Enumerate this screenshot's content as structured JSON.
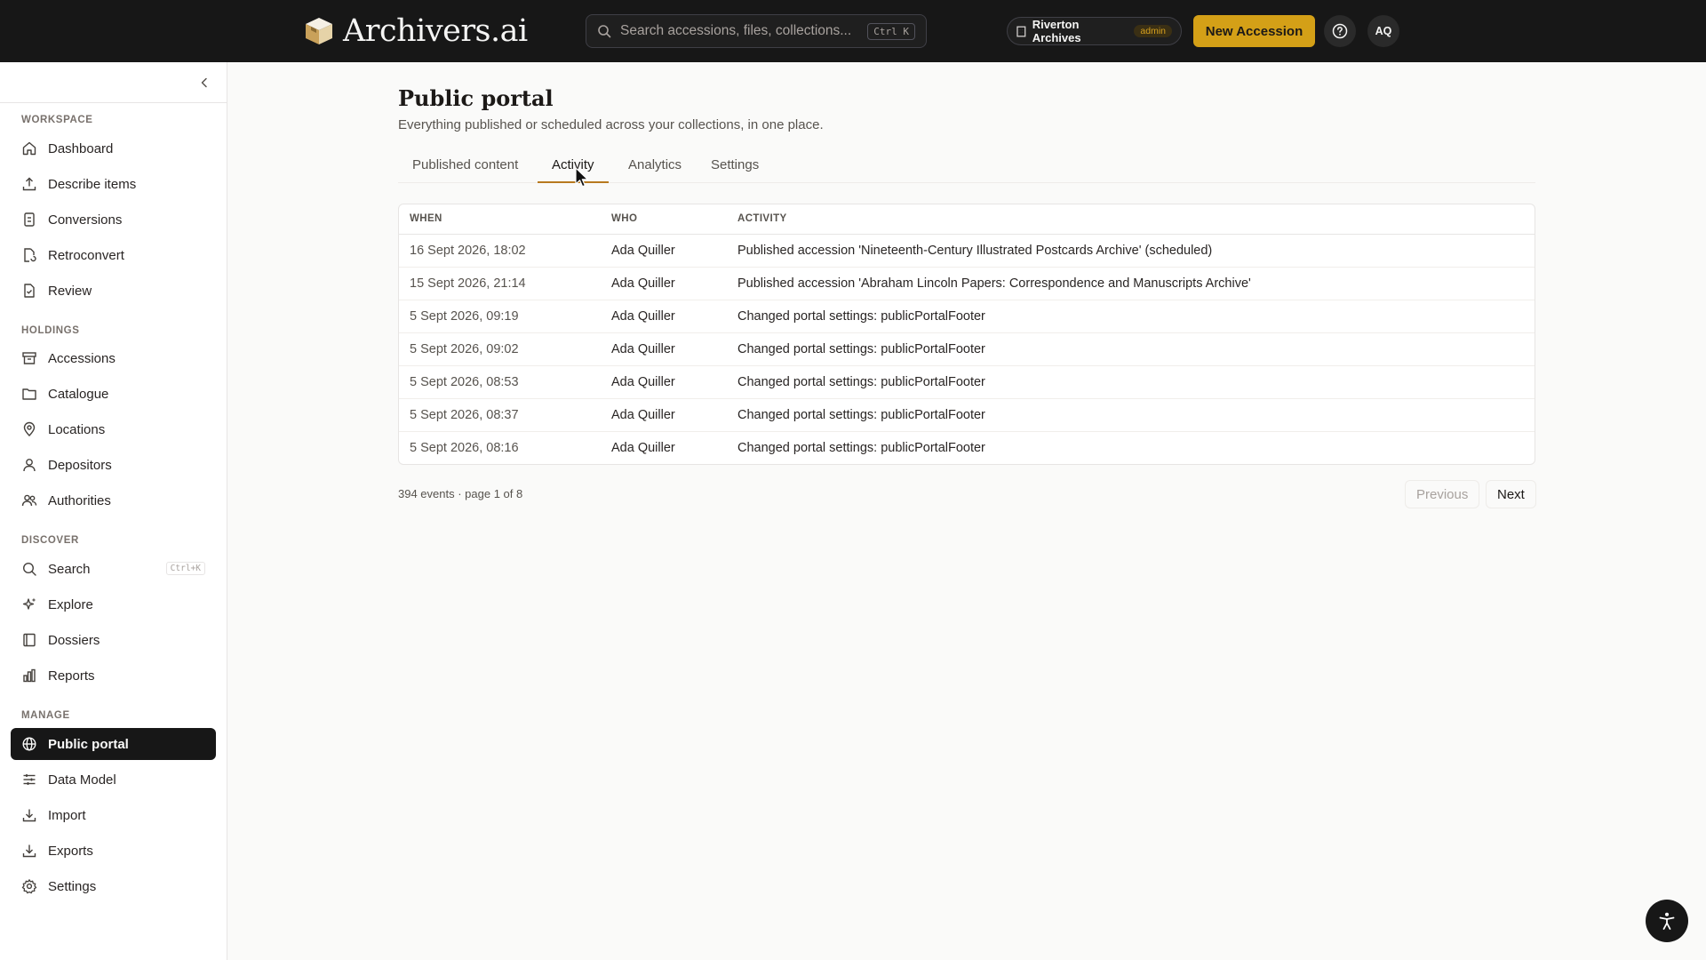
{
  "header": {
    "brand": "Archivers.ai",
    "search_placeholder": "Search accessions, files, collections...",
    "search_shortcut": "Ctrl K",
    "org_name": "Riverton Archives",
    "org_role": "admin",
    "new_accession_label": "New Accession",
    "avatar_initials": "AQ"
  },
  "sidebar": {
    "sections": [
      {
        "label": "WORKSPACE",
        "items": [
          "Dashboard",
          "Describe items",
          "Conversions",
          "Retroconvert",
          "Review"
        ]
      },
      {
        "label": "HOLDINGS",
        "items": [
          "Accessions",
          "Catalogue",
          "Locations",
          "Depositors",
          "Authorities"
        ]
      },
      {
        "label": "DISCOVER",
        "items": [
          "Search",
          "Explore",
          "Dossiers",
          "Reports"
        ]
      },
      {
        "label": "MANAGE",
        "items": [
          "Public portal",
          "Data Model",
          "Import",
          "Exports",
          "Settings"
        ]
      }
    ],
    "search_shortcut": "Ctrl+K",
    "active_item": "Public portal"
  },
  "main": {
    "title": "Public portal",
    "subtitle": "Everything published or scheduled across your collections, in one place.",
    "tabs": [
      "Published content",
      "Activity",
      "Analytics",
      "Settings"
    ],
    "active_tab": "Activity",
    "table": {
      "columns": [
        "WHEN",
        "WHO",
        "ACTIVITY"
      ],
      "rows": [
        [
          "16 Sept 2026, 18:02",
          "Ada Quiller",
          "Published accession 'Nineteenth-Century Illustrated Postcards Archive' (scheduled)"
        ],
        [
          "15 Sept 2026, 21:14",
          "Ada Quiller",
          "Published accession 'Abraham Lincoln Papers: Correspondence and Manuscripts Archive'"
        ],
        [
          "5 Sept 2026, 09:19",
          "Ada Quiller",
          "Changed portal settings: publicPortalFooter"
        ],
        [
          "5 Sept 2026, 09:02",
          "Ada Quiller",
          "Changed portal settings: publicPortalFooter"
        ],
        [
          "5 Sept 2026, 08:53",
          "Ada Quiller",
          "Changed portal settings: publicPortalFooter"
        ],
        [
          "5 Sept 2026, 08:37",
          "Ada Quiller",
          "Changed portal settings: publicPortalFooter"
        ],
        [
          "5 Sept 2026, 08:16",
          "Ada Quiller",
          "Changed portal settings: publicPortalFooter"
        ]
      ]
    },
    "pager": {
      "info": "394 events · page 1 of 8",
      "previous_label": "Previous",
      "next_label": "Next"
    }
  },
  "colors": {
    "accent": "#d4a017",
    "topbar": "#171717",
    "active_nav": "#171717"
  }
}
